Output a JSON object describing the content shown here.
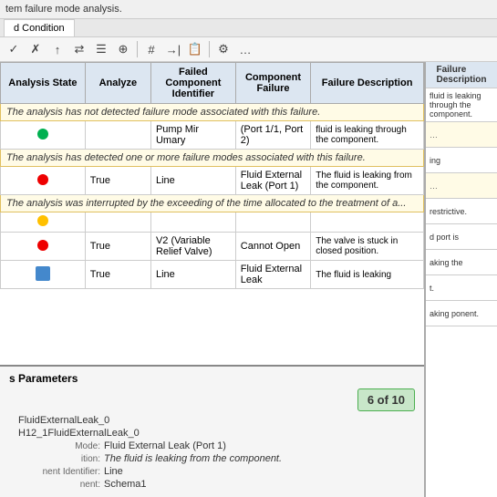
{
  "topbar": {
    "text": "tem failure mode analysis."
  },
  "tabs": [
    {
      "label": "d Condition"
    }
  ],
  "toolbar": {
    "icons": [
      "✓",
      "✗",
      "↑",
      "↔",
      "≡",
      "⊕",
      "#",
      "→|",
      "📋",
      "⚙",
      "…"
    ]
  },
  "table": {
    "headers": [
      "Analysis State",
      "Analyze",
      "Failed Component Identifier",
      "Component Failure",
      "Failure Description"
    ],
    "rows": [
      {
        "type": "tooltip",
        "colspan": 5,
        "text": "The analysis has not detected failure mode associated with this failure."
      },
      {
        "type": "data",
        "dot": "green",
        "analyze": "",
        "failed_component": "Pump Mir Umary",
        "component_failure": "(Port 1/1, Port 2)",
        "failure_description": "fluid is leaking through the component.",
        "right_extra": "fluid is leaking through the component."
      },
      {
        "type": "tooltip",
        "colspan": 5,
        "text": "The analysis has detected one or more failure modes associated with this failure."
      },
      {
        "type": "data",
        "dot": "red",
        "analyze": "True",
        "failed_component": "Line",
        "component_failure": "Fluid External Leak (Port 1)",
        "failure_description": "The fluid is leaking from the component.",
        "right_extra": "ing"
      },
      {
        "type": "tooltip",
        "colspan": 5,
        "text": "The analysis was interrupted by the exceeding of the time allocated to the treatment of a..."
      },
      {
        "type": "data",
        "dot": "yellow",
        "analyze": "",
        "failed_component": "",
        "component_failure": "",
        "failure_description": "",
        "right_extra": "restrictive."
      },
      {
        "type": "data",
        "dot": "red",
        "analyze": "True",
        "failed_component": "V2 (Variable Relief Valve)",
        "component_failure": "Cannot Open",
        "failure_description": "The valve is stuck in closed position.",
        "right_extra": "d"
      },
      {
        "type": "data",
        "dot": "status",
        "analyze": "True",
        "failed_component": "Line",
        "component_failure": "Fluid External Leak",
        "failure_description": "The fluid is leaking",
        "right_extra": "ponent."
      }
    ]
  },
  "bottom": {
    "title": "s Parameters",
    "counter": "6 of 10",
    "params": [
      {
        "label": "",
        "value": "FluidExternalLeak_0",
        "italic": false
      },
      {
        "label": "",
        "value": "H12_1FluidExternalLeak_0",
        "italic": false
      },
      {
        "label": "Mode:",
        "value": "Fluid External Leak (Port 1)",
        "italic": false
      },
      {
        "label": "ition:",
        "value": "The fluid is leaking from the component.",
        "italic": true
      },
      {
        "label": "nent Identifier:",
        "value": "Line",
        "italic": false
      },
      {
        "label": "nent:",
        "value": "Schema1",
        "italic": false
      }
    ]
  },
  "right_col_data": [
    "fluid is leaking through the component.",
    "ing",
    "restrictive.",
    "d port is",
    "aking the",
    "t.",
    "aking ponent."
  ]
}
